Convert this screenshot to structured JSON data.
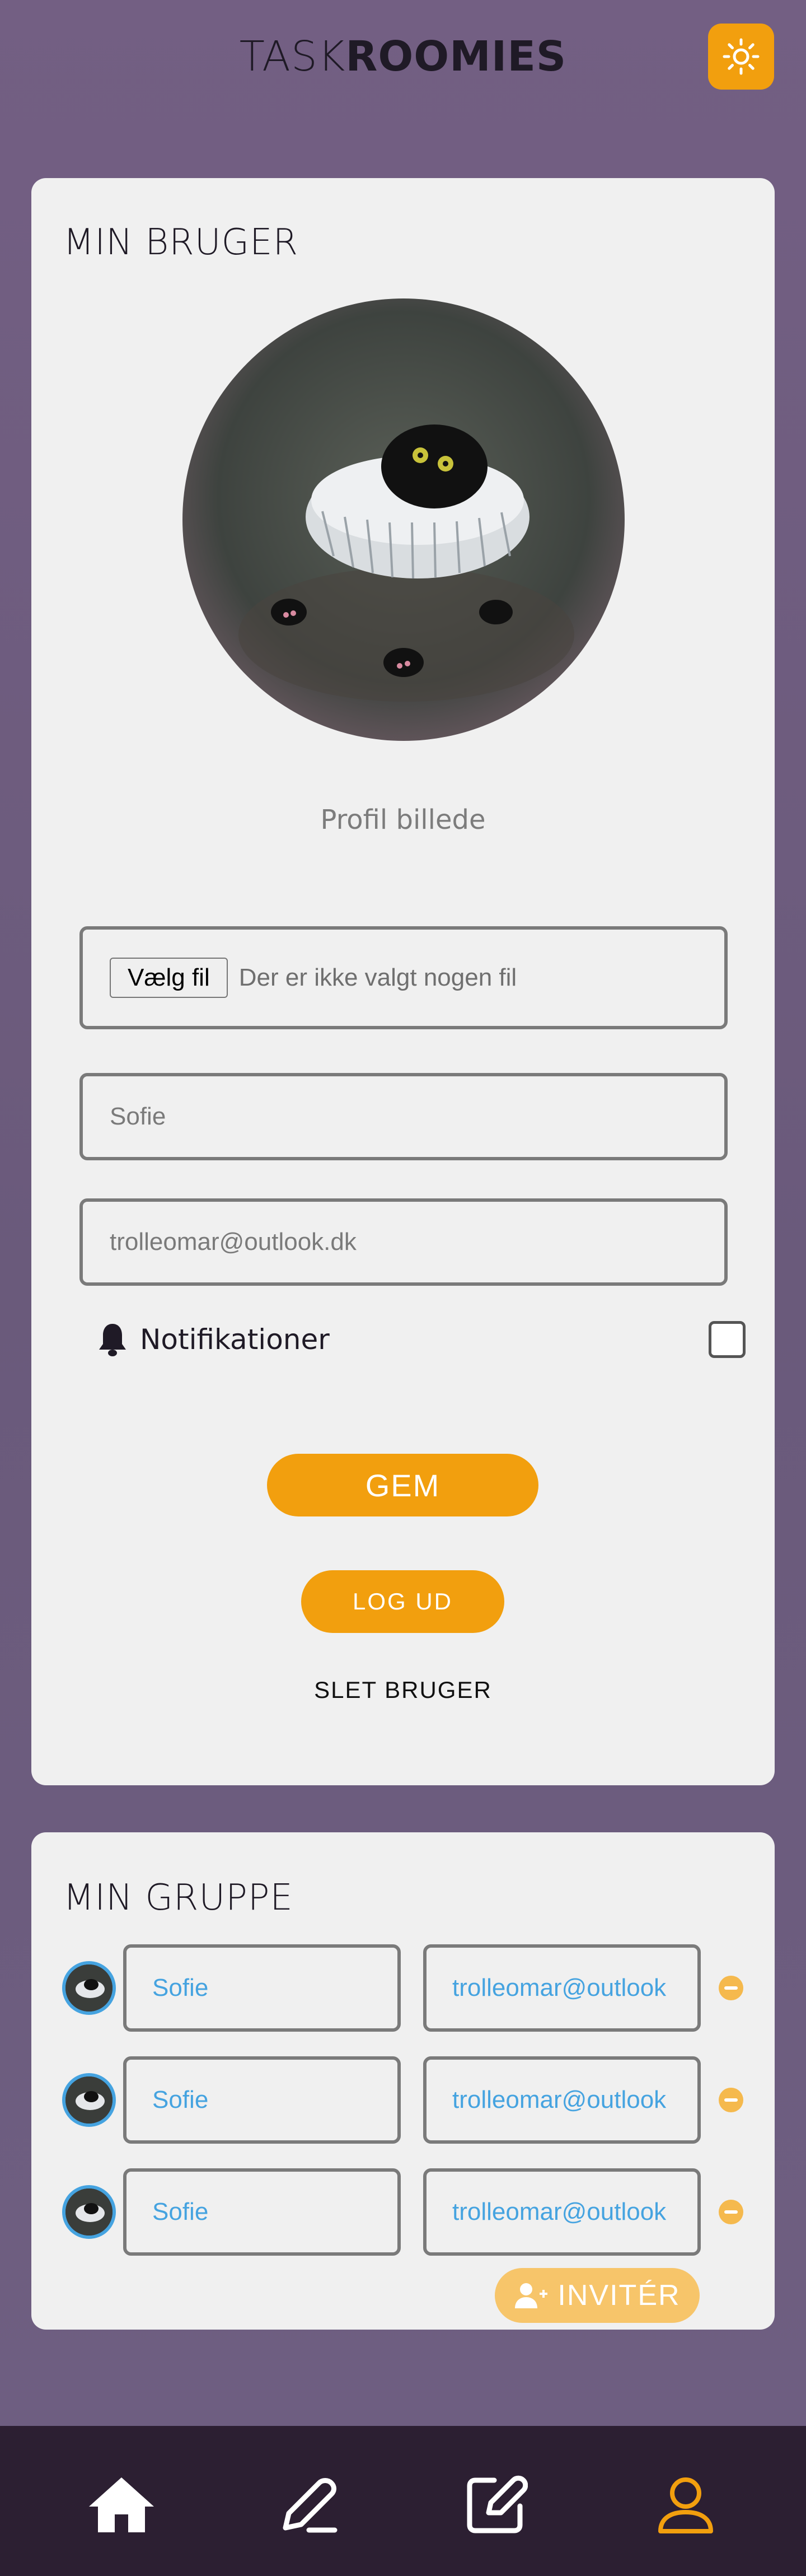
{
  "header": {
    "logo_light": "TASK",
    "logo_bold": "ROOMIES",
    "theme_icon": "sun-icon"
  },
  "user_card": {
    "title": "MIN BRUGER",
    "avatar_caption": "Profil billede",
    "file_button": "Vælg fil",
    "file_status": "Der er ikke valgt nogen fil",
    "name_value": "Sofie",
    "email_value": "trolleomar@outlook.dk",
    "notifications_label": "Notifikationer",
    "notifications_checked": false,
    "save_label": "GEM",
    "logout_label": "LOG UD",
    "delete_label": "SLET BRUGER"
  },
  "group_card": {
    "title": "MIN GRUPPE",
    "members": [
      {
        "name": "Sofie",
        "email": "trolleomar@outlook"
      },
      {
        "name": "Sofie",
        "email": "trolleomar@outlook"
      },
      {
        "name": "Sofie",
        "email": "trolleomar@outlook"
      }
    ],
    "invite_label": "INVITÉR"
  },
  "bottom_nav": {
    "items": [
      "home-icon",
      "pencil-icon",
      "edit-icon",
      "user-icon"
    ],
    "active": "user-icon"
  },
  "colors": {
    "accent": "#f29f0e",
    "link": "#45a3e0",
    "nav_bg": "#2c1f32",
    "page_bg": "#6f5f82"
  }
}
